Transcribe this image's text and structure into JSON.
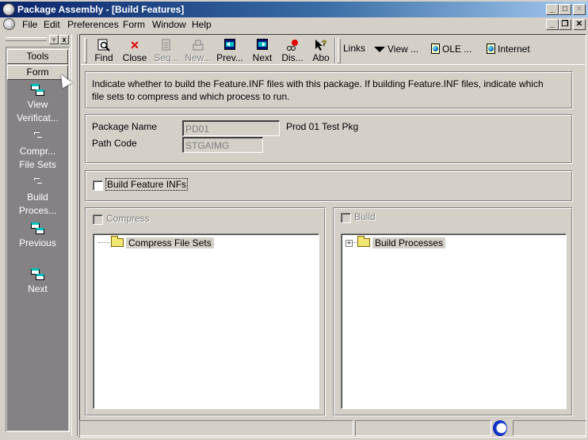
{
  "window": {
    "title": "Package Assembly - [Build Features]",
    "title_buttons": {
      "minimize": "_",
      "maximize": "□",
      "close": "✕"
    },
    "doc_buttons": {
      "minimize": "_",
      "restore": "❐",
      "close": "✕"
    }
  },
  "menu": {
    "items": [
      "File",
      "Edit",
      "Preferences",
      "Form",
      "Window",
      "Help"
    ]
  },
  "left_panel": {
    "header_buttons": {
      "dropdown": "▾",
      "close": "x"
    },
    "tabs": [
      "Tools",
      "Form"
    ],
    "items": [
      {
        "label_line1": "View",
        "label_line2": "Verificat...",
        "icon": "window-link-icon"
      },
      {
        "label_line1": "Compr...",
        "label_line2": "File Sets",
        "icon": "dash-icon"
      },
      {
        "label_line1": "Build",
        "label_line2": "Proces...",
        "icon": "dash-icon"
      },
      {
        "label_line1": "Previous",
        "label_line2": "",
        "icon": "window-link-icon"
      },
      {
        "label_line1": "Next",
        "label_line2": "",
        "icon": "window-link-icon"
      }
    ]
  },
  "toolbar": {
    "buttons": [
      {
        "label": "Find",
        "icon": "find-icon",
        "enabled": true
      },
      {
        "label": "Close",
        "icon": "close-x-icon",
        "enabled": true
      },
      {
        "label": "Seq...",
        "icon": "sequence-icon",
        "enabled": false
      },
      {
        "label": "New...",
        "icon": "new-icon",
        "enabled": false
      },
      {
        "label": "Prev...",
        "icon": "previous-icon",
        "enabled": true
      },
      {
        "label": "Next",
        "icon": "next-icon",
        "enabled": true
      },
      {
        "label": "Dis...",
        "icon": "display-icon",
        "enabled": true
      },
      {
        "label": "Abo",
        "icon": "about-icon",
        "enabled": true
      }
    ],
    "links_label": "Links",
    "view_label": "View ...",
    "ole_label": "OLE ...",
    "internet_label": "Internet"
  },
  "form": {
    "instructions_line1": "Indicate whether to build the Feature.INF files with this package.  If building Feature.INF files, indicate which",
    "instructions_line2": "file sets to compress and which process to run.",
    "package_name_label": "Package Name",
    "package_name_value": "PD01",
    "package_description": "Prod 01 Test Pkg",
    "path_code_label": "Path Code",
    "path_code_value": "STGAIMG",
    "build_feature_infs_label": "Build Feature INFs",
    "build_feature_infs_checked": false,
    "compress_label": "Compress",
    "compress_checked": false,
    "build_label": "Build",
    "build_checked": false,
    "compress_tree": [
      {
        "label": "Compress File Sets",
        "expandable": false
      }
    ],
    "build_tree": [
      {
        "label": "Build Processes",
        "expandable": true,
        "expander": "+"
      }
    ]
  },
  "status_bar": {
    "cells": [
      "",
      "",
      ""
    ]
  }
}
